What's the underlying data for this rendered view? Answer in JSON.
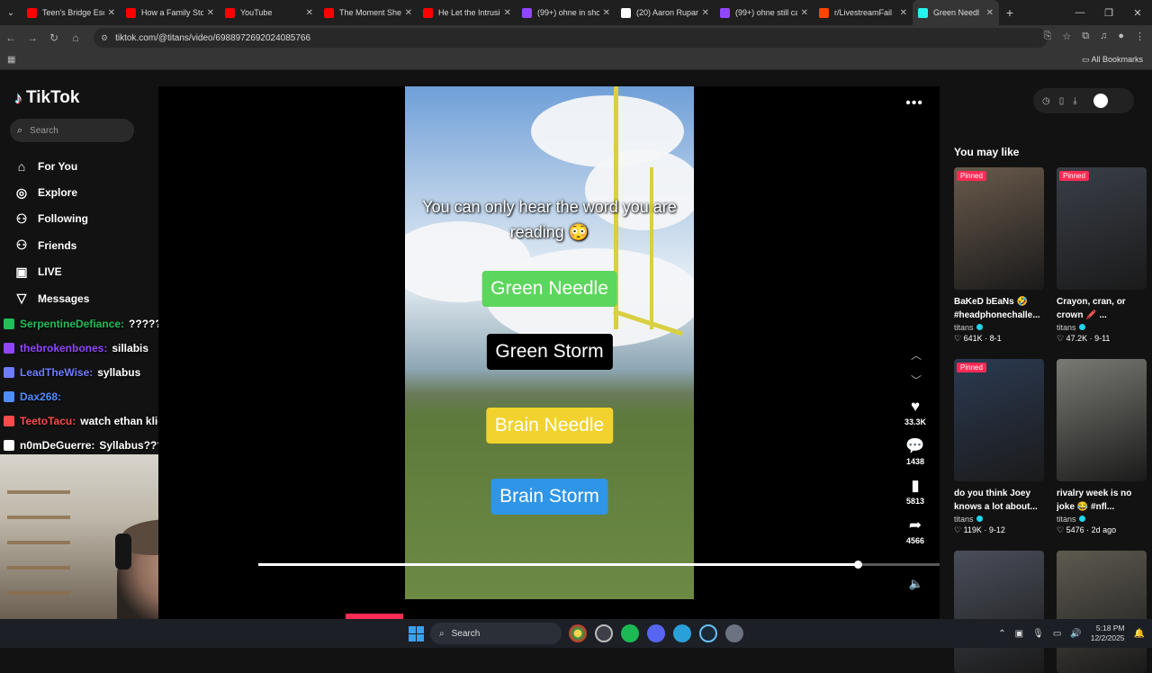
{
  "browser": {
    "tabs": [
      {
        "title": "Teen's Bridge Esca",
        "color": "#ff0000"
      },
      {
        "title": "How a Family Sto",
        "color": "#ff0000"
      },
      {
        "title": "YouTube",
        "color": "#ff0000"
      },
      {
        "title": "The Moment She",
        "color": "#ff0000"
      },
      {
        "title": "He Let the Intrusi",
        "color": "#ff0000"
      },
      {
        "title": "(99+) ohne in sho",
        "color": "#9146ff"
      },
      {
        "title": "(20) Aaron Rupar",
        "color": "#ffffff"
      },
      {
        "title": "(99+) ohne still ca",
        "color": "#9146ff"
      },
      {
        "title": "r/LivestreamFail",
        "color": "#ff4500"
      },
      {
        "title": "Green Needl",
        "color": "#25f4ee",
        "active": true
      }
    ],
    "url": "tiktok.com/@titans/video/6988972692024085766",
    "all_bookmarks": "All Bookmarks"
  },
  "sidebar": {
    "brand": "TikTok",
    "search_placeholder": "Search",
    "nav": [
      {
        "label": "For You",
        "icon": "home-icon"
      },
      {
        "label": "Explore",
        "icon": "compass-icon"
      },
      {
        "label": "Following",
        "icon": "following-icon"
      },
      {
        "label": "Friends",
        "icon": "friends-icon"
      },
      {
        "label": "LIVE",
        "icon": "live-icon"
      },
      {
        "label": "Messages",
        "icon": "messages-icon"
      }
    ]
  },
  "chat": [
    {
      "user": "SerpentineDefiance:",
      "msg": "??????????",
      "color": "#1fbf5a"
    },
    {
      "user": "thebrokenbones:",
      "msg": "sillabis",
      "color": "#9146ff"
    },
    {
      "user": "LeadTheWise:",
      "msg": "syllabus",
      "color": "#6f7bff"
    },
    {
      "user": "Dax268:",
      "msg": "",
      "color": "#4f8cff"
    },
    {
      "user": "TeetoTacu:",
      "msg": "watch ethan klien",
      "color": "#ff4b4b"
    },
    {
      "user": "n0mDeGuerre:",
      "msg": "Syllabus???",
      "color": "#ffffff"
    }
  ],
  "video": {
    "caption": "You can only hear the word you are reading 😳",
    "buttons": [
      {
        "label": "Green Needle",
        "bg": "#5cd65c",
        "fg": "#ffffff"
      },
      {
        "label": "Green Storm",
        "bg": "#000000",
        "fg": "#ffffff"
      },
      {
        "label": "Brain Needle",
        "bg": "#f2d22e",
        "fg": "#ffffff"
      },
      {
        "label": "Brain Storm",
        "bg": "#2f95e6",
        "fg": "#ffffff"
      }
    ],
    "progress": 0.88,
    "actions": {
      "likes": "33.3K",
      "comments": "1438",
      "saves": "5813",
      "shares": "4566"
    }
  },
  "you_may_like": {
    "title": "You may like",
    "cards": [
      {
        "title": "BaKeD bEaNs 🤣 #headphonechalle...",
        "author": "titans",
        "stats": "♡ 641K · 8-1",
        "pinned": true,
        "pin_label": "Pinned",
        "thumb": "#6a5a4c"
      },
      {
        "title": "Crayon, cran, or crown 🖍️ ...",
        "author": "titans",
        "stats": "♡ 47.2K · 9-11",
        "pinned": true,
        "pin_label": "Pinned",
        "thumb": "#3a3f48"
      },
      {
        "title": "do you think Joey knows a lot about...",
        "author": "titans",
        "stats": "♡ 119K · 9-12",
        "pinned": true,
        "pin_label": "Pinned",
        "thumb": "#2c3a52"
      },
      {
        "title": "rivalry week is no joke 😂 #nfl...",
        "author": "titans",
        "stats": "♡ 5476 · 2d ago",
        "pinned": false,
        "pin_label": "",
        "thumb": "#7a7a74"
      },
      {
        "title": "",
        "author": "",
        "stats": "",
        "pinned": false,
        "pin_label": "",
        "thumb": "#4a4e5a"
      },
      {
        "title": "",
        "author": "",
        "stats": "",
        "pinned": false,
        "pin_label": "",
        "thumb": "#5e5a50"
      }
    ]
  },
  "taskbar": {
    "search": "Search",
    "time": "5:18 PM",
    "date": "12/2/2025"
  }
}
